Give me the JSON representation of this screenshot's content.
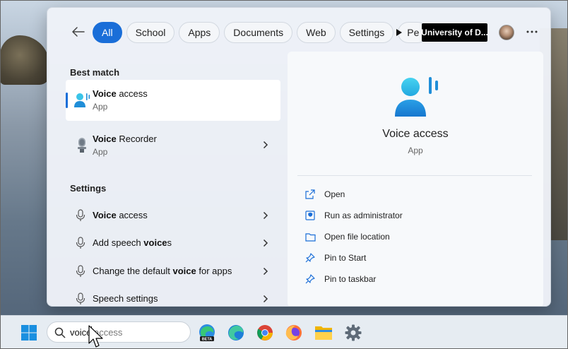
{
  "search_flyout": {
    "filters": [
      {
        "label": "All",
        "active": true
      },
      {
        "label": "School",
        "active": false
      },
      {
        "label": "Apps",
        "active": false
      },
      {
        "label": "Documents",
        "active": false
      },
      {
        "label": "Web",
        "active": false
      },
      {
        "label": "Settings",
        "active": false
      },
      {
        "label": "Pe",
        "active": false
      }
    ],
    "org_label": "University of D...",
    "best_match_header": "Best match",
    "best_match": [
      {
        "pre": "",
        "bold": "Voice",
        "post": " access",
        "subtitle": "App"
      },
      {
        "pre": "",
        "bold": "Voice",
        "post": " Recorder",
        "subtitle": "App"
      }
    ],
    "settings_header": "Settings",
    "settings": [
      {
        "pre": "",
        "bold": "Voice",
        "post": " access"
      },
      {
        "pre": "Add speech ",
        "bold": "voice",
        "post": "s"
      },
      {
        "pre": "Change the default ",
        "bold": "voice",
        "post": " for apps"
      },
      {
        "pre": "Speech settings",
        "bold": "",
        "post": ""
      }
    ],
    "detail": {
      "title": "Voice access",
      "subtitle": "App",
      "actions": [
        {
          "label": "Open",
          "icon": "open-external-icon"
        },
        {
          "label": "Run as administrator",
          "icon": "shield-icon"
        },
        {
          "label": "Open file location",
          "icon": "folder-icon"
        },
        {
          "label": "Pin to Start",
          "icon": "pin-icon"
        },
        {
          "label": "Pin to taskbar",
          "icon": "pin-icon"
        }
      ]
    }
  },
  "taskbar": {
    "search_typed": "voice",
    "search_suggestion": " access",
    "apps": [
      "edge-beta-icon",
      "edge-icon",
      "chrome-icon",
      "firefox-icon",
      "file-explorer-icon",
      "settings-gear-icon"
    ],
    "edge_beta_badge": "BETA"
  },
  "colors": {
    "accent": "#1a6ed8",
    "voice_icon_light": "#3ac4e8",
    "voice_icon_dark": "#1f8ed8"
  }
}
